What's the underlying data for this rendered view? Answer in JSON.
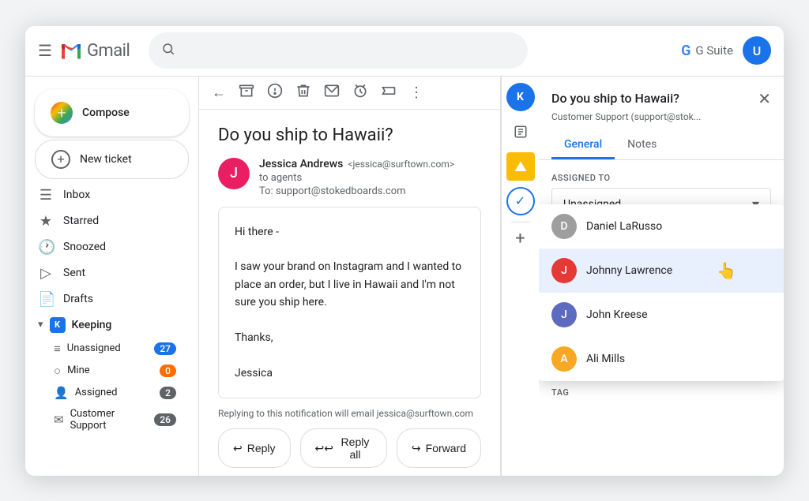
{
  "app": {
    "name": "Gmail",
    "search_placeholder": ""
  },
  "top_bar": {
    "menu_icon": "☰",
    "gmail_label": "Gmail",
    "gsuite_label": "G Suite",
    "user_avatar": "U"
  },
  "sidebar": {
    "compose_label": "Compose",
    "new_ticket_label": "New ticket",
    "nav_items": [
      {
        "icon": "☰",
        "label": "Inbox",
        "count": ""
      },
      {
        "icon": "★",
        "label": "Starred",
        "count": ""
      },
      {
        "icon": "🕐",
        "label": "Snoozed",
        "count": ""
      },
      {
        "icon": "▷",
        "label": "Sent",
        "count": ""
      },
      {
        "icon": "📄",
        "label": "Drafts",
        "count": ""
      }
    ],
    "keeping_label": "Keeping",
    "sub_items": [
      {
        "icon": "≡",
        "label": "Unassigned",
        "badge": "27",
        "badge_class": "badge-blue"
      },
      {
        "icon": "○",
        "label": "Mine",
        "badge": "0",
        "badge_class": "badge-orange"
      },
      {
        "icon": "👤",
        "label": "Assigned",
        "badge": "2",
        "badge_class": "badge-gray"
      },
      {
        "icon": "✉",
        "label": "Customer Support",
        "badge": "26",
        "badge_class": "badge-gray"
      }
    ]
  },
  "email": {
    "subject": "Do you ship to Hawaii?",
    "sender_name": "Jessica Andrews",
    "sender_email": "<jessica@surftown.com>",
    "to_line": "to agents",
    "to_address": "To: support@stokedboards.com",
    "sender_initial": "J",
    "body_lines": [
      "Hi there -",
      "",
      "I saw your brand on Instagram and I wanted to place an order, but I live in Hawaii and I'm not sure you ship here.",
      "",
      "Thanks,",
      "",
      "Jessica"
    ],
    "reply_notice": "Replying to this notification will email jessica@surftown.com",
    "reply_btn": "Reply",
    "reply_all_btn": "Reply all",
    "forward_btn": "Forward"
  },
  "toolbar": {
    "back_icon": "←",
    "archive_icon": "🗂",
    "report_icon": "⚠",
    "trash_icon": "🗑",
    "envelope_icon": "✉",
    "snooze_icon": "⏰",
    "label_icon": "🏷",
    "more_icon": "⋮"
  },
  "right_panel": {
    "title": "Do you ship to Hawaii?",
    "subtitle": "Customer Support (support@stok...",
    "close_icon": "✕",
    "tabs": [
      {
        "label": "General",
        "active": true
      },
      {
        "label": "Notes",
        "active": false
      }
    ],
    "assigned_to_label": "ASSIGNED TO",
    "assigned_value": "Unassigned",
    "dropdown_arrow": "▾",
    "tag_label": "TAG",
    "agents": [
      {
        "name": "Daniel LaRusso",
        "initial": "D",
        "color": "#9e9e9e"
      },
      {
        "name": "Johnny Lawrence",
        "initial": "J",
        "color": "#e53935",
        "highlighted": true
      },
      {
        "name": "John Kreese",
        "initial": "J",
        "color": "#5c6bc0"
      },
      {
        "name": "Ali Mills",
        "initial": "A",
        "color": "#fdd835"
      }
    ]
  },
  "mini_panel": {
    "icons": [
      "K",
      "≡",
      "!",
      "+"
    ]
  }
}
